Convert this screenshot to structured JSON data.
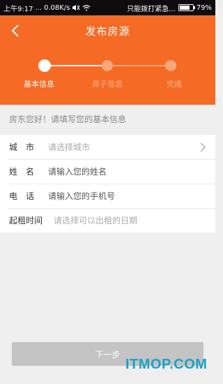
{
  "status_bar": {
    "time": "上午9:17",
    "dots": "...",
    "speed": "0.08K/s",
    "carrier": "只能拨打紧急...",
    "battery_percent": "79%",
    "battery_level": 0.79
  },
  "header": {
    "title": "发布房源",
    "back_icon": "chevron-left-icon"
  },
  "steps": [
    {
      "label": "基本信息",
      "state": "active"
    },
    {
      "label": "房子信息",
      "state": "inactive"
    },
    {
      "label": "完成",
      "state": "inactive"
    }
  ],
  "hint": "房东您好！请填写您的基本信息",
  "form": {
    "city": {
      "label": "城　市",
      "placeholder": "请选择城市"
    },
    "name": {
      "label": "姓　名",
      "placeholder": "请输入您的姓名"
    },
    "phone": {
      "label": "电　话",
      "placeholder": "请输入您的手机号"
    },
    "start_date": {
      "label": "起租时间",
      "placeholder": "请选择可以出租的日期"
    }
  },
  "next_button": "下一步",
  "watermark": "ITMOP.COM",
  "colors": {
    "brand": "#f56a24",
    "button_disabled": "#c4c4c4",
    "watermark": "#1da1c8"
  }
}
